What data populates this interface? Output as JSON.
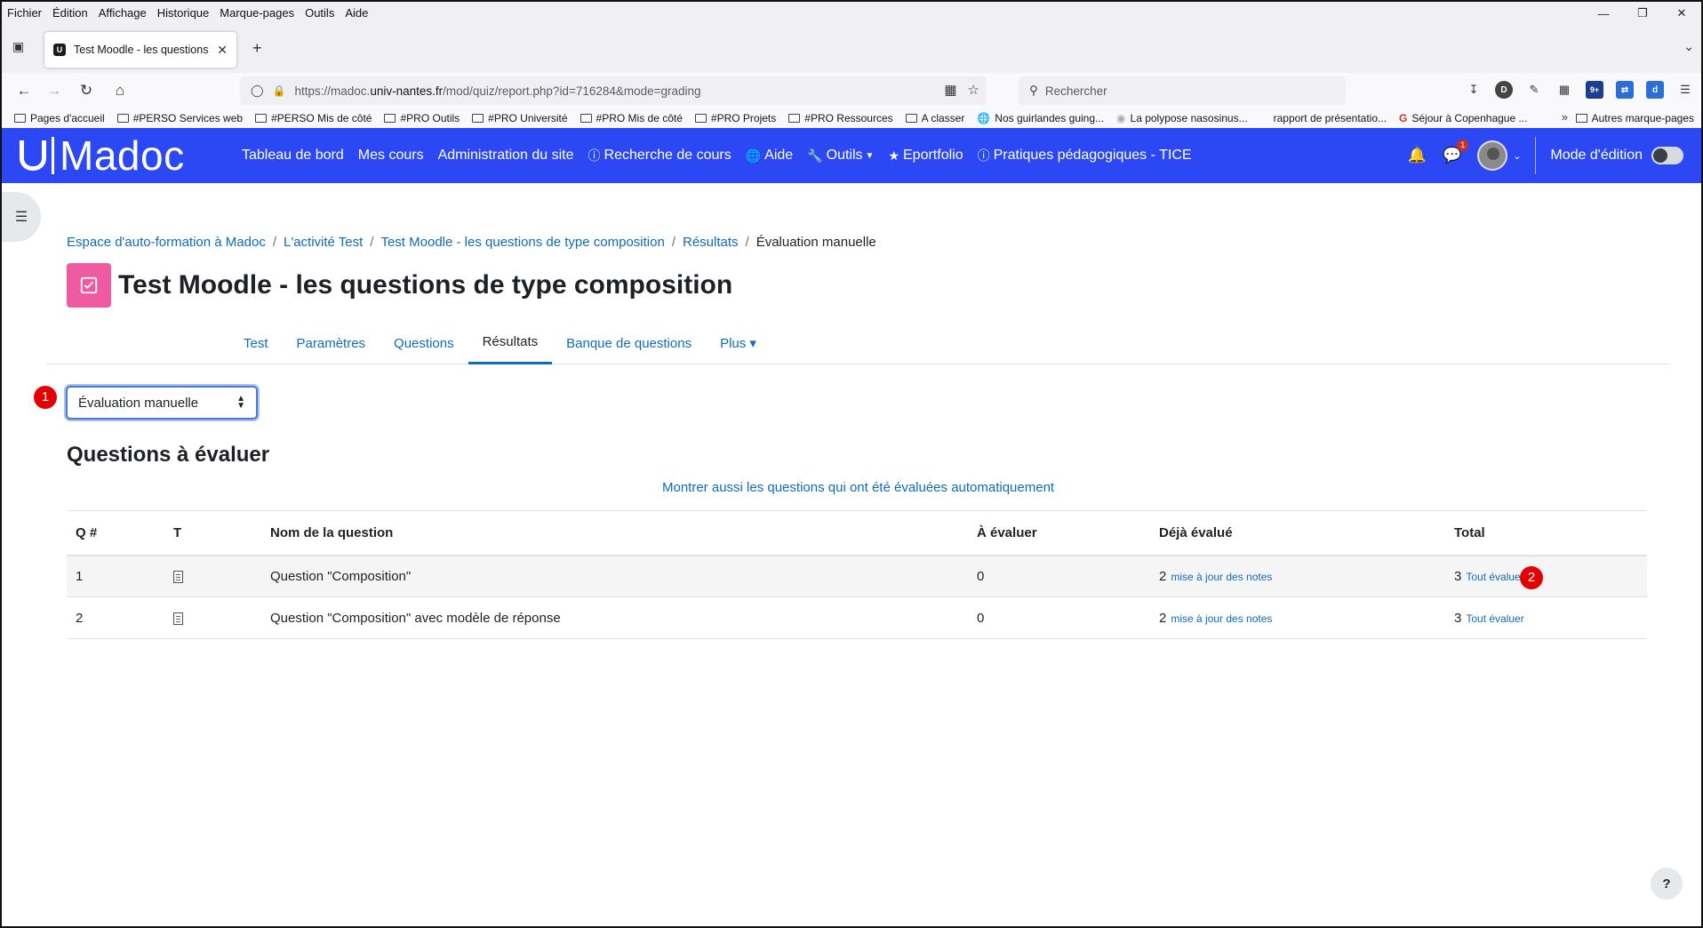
{
  "browser": {
    "menu": [
      "Fichier",
      "Édition",
      "Affichage",
      "Historique",
      "Marque-pages",
      "Outils",
      "Aide"
    ],
    "tab_title": "Test Moodle - les questions de t",
    "url_prefix": "https://madoc.",
    "url_domain": "univ-nantes.fr",
    "url_path": "/mod/quiz/report.php?id=716284&mode=grading",
    "search_placeholder": "Rechercher",
    "bookmarks": [
      {
        "label": "Pages d'accueil",
        "icon": "folder-icon"
      },
      {
        "label": "#PERSO Services web",
        "icon": "folder-icon"
      },
      {
        "label": "#PERSO Mis de côté",
        "icon": "folder-icon"
      },
      {
        "label": "#PRO Outils",
        "icon": "folder-icon"
      },
      {
        "label": "#PRO Université",
        "icon": "folder-icon"
      },
      {
        "label": "#PRO Mis de côté",
        "icon": "folder-icon"
      },
      {
        "label": "#PRO Projets",
        "icon": "folder-icon"
      },
      {
        "label": "#PRO Ressources",
        "icon": "folder-icon"
      },
      {
        "label": "A classer",
        "icon": "folder-icon"
      },
      {
        "label": "Nos guirlandes guing...",
        "icon": "globe-icon"
      },
      {
        "label": "La polypose nasosinus...",
        "icon": "page-icon"
      },
      {
        "label": "rapport de présentatio...",
        "icon": "none"
      },
      {
        "label": "Séjour à Copenhague ...",
        "icon": "google-icon"
      }
    ],
    "bookmarks_other": "Autres marque-pages",
    "toolbar_badge": "9+"
  },
  "moodle": {
    "logo": "Madoc",
    "nav": [
      {
        "label": "Tableau de bord",
        "icon": ""
      },
      {
        "label": "Mes cours",
        "icon": ""
      },
      {
        "label": "Administration du site",
        "icon": ""
      },
      {
        "label": "Recherche de cours",
        "icon": "info-circle-icon"
      },
      {
        "label": "Aide",
        "icon": "globe-icon"
      },
      {
        "label": "Outils",
        "icon": "wrench-icon"
      },
      {
        "label": "Eportfolio",
        "icon": "star-icon"
      },
      {
        "label": "Pratiques pédagogiques - TICE",
        "icon": "info-circle-icon"
      }
    ],
    "message_count": "1",
    "edit_mode_label": "Mode d'édition",
    "edit_mode_on": false
  },
  "breadcrumb": [
    "Espace d'auto-formation à Madoc",
    "L'activité Test",
    "Test Moodle - les questions de type composition",
    "Résultats",
    "Évaluation manuelle"
  ],
  "page_title": "Test Moodle - les questions de type composition",
  "secondary_nav": [
    {
      "label": "Test",
      "active": false
    },
    {
      "label": "Paramètres",
      "active": false
    },
    {
      "label": "Questions",
      "active": false
    },
    {
      "label": "Résultats",
      "active": true
    },
    {
      "label": "Banque de questions",
      "active": false
    },
    {
      "label": "Plus ▾",
      "active": false
    }
  ],
  "report_select": {
    "value": "Évaluation manuelle"
  },
  "badges": {
    "first": "1",
    "second": "2"
  },
  "section_title": "Questions à évaluer",
  "show_auto_link": "Montrer aussi les questions qui ont été évaluées automatiquement",
  "table": {
    "headers": [
      "Q #",
      "T",
      "Nom de la question",
      "À évaluer",
      "Déjà évalué",
      "Total"
    ],
    "rows": [
      {
        "q": "1",
        "name": "Question \"Composition\"",
        "to_grade": "0",
        "graded": "2",
        "graded_link": "mise à jour des notes",
        "total": "3",
        "total_link": "Tout évaluer"
      },
      {
        "q": "2",
        "name": "Question \"Composition\" avec modèle de réponse",
        "to_grade": "0",
        "graded": "2",
        "graded_link": "mise à jour des notes",
        "total": "3",
        "total_link": "Tout évaluer"
      }
    ]
  },
  "help": "?",
  "colors": {
    "moodle_blue": "#2b48f4",
    "link": "#0f6cbf",
    "activity_pink": "#ef5ba1",
    "badge_red": "#e40000"
  }
}
